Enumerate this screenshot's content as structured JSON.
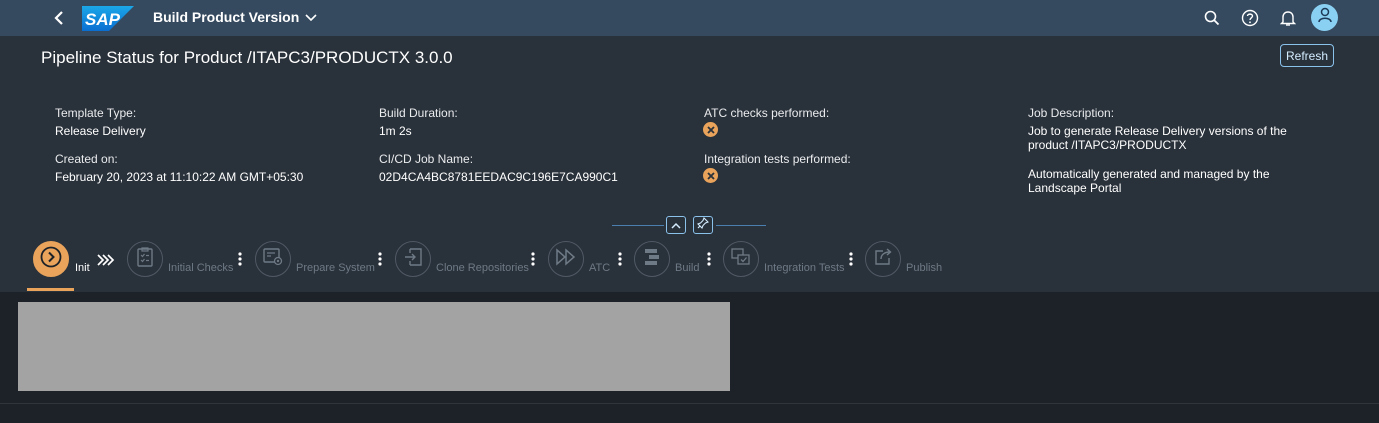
{
  "shell": {
    "logo_text": "SAP",
    "app_title": "Build Product Version",
    "icons": [
      "back-icon",
      "search-icon",
      "help-icon",
      "bell-icon",
      "user-icon",
      "chevron-down-icon"
    ]
  },
  "header": {
    "page_title": "Pipeline Status for Product /ITAPC3/PRODUCTX 3.0.0",
    "refresh_label": "Refresh",
    "fields": {
      "template_type_label": "Template Type:",
      "template_type_value": "Release Delivery",
      "created_on_label": "Created on:",
      "created_on_value": "February 20, 2023 at 11:10:22 AM GMT+05:30",
      "build_duration_label": "Build Duration:",
      "build_duration_value": "1m 2s",
      "job_name_label": "CI/CD Job Name:",
      "job_name_value": "02D4CA4BC8781EEDAC9C196E7CA990C1",
      "atc_label": "ATC checks performed:",
      "integration_label": "Integration tests performed:",
      "job_desc_label": "Job Description:",
      "job_desc_line1": "Job to generate Release Delivery versions of the",
      "job_desc_line2": "product /ITAPC3/PRODUCTX",
      "job_desc_line3": "Automatically generated and managed by the",
      "job_desc_line4": "Landscape Portal"
    }
  },
  "steps": [
    {
      "label": "Init",
      "icon": "play-circle-icon",
      "active": true
    },
    {
      "label": "Initial Checks",
      "icon": "checklist-icon"
    },
    {
      "label": "Prepare System",
      "icon": "system-settings-icon"
    },
    {
      "label": "Clone Repositories",
      "icon": "clone-icon"
    },
    {
      "label": "ATC",
      "icon": "fast-forward-icon"
    },
    {
      "label": "Build",
      "icon": "build-icon"
    },
    {
      "label": "Integration Tests",
      "icon": "integration-icon"
    },
    {
      "label": "Publish",
      "icon": "share-icon"
    }
  ],
  "colors": {
    "shell": "#354a5f",
    "header": "#29313a",
    "background": "#1c2228",
    "accent": "#e9a35b",
    "link": "#8ac2eb"
  }
}
